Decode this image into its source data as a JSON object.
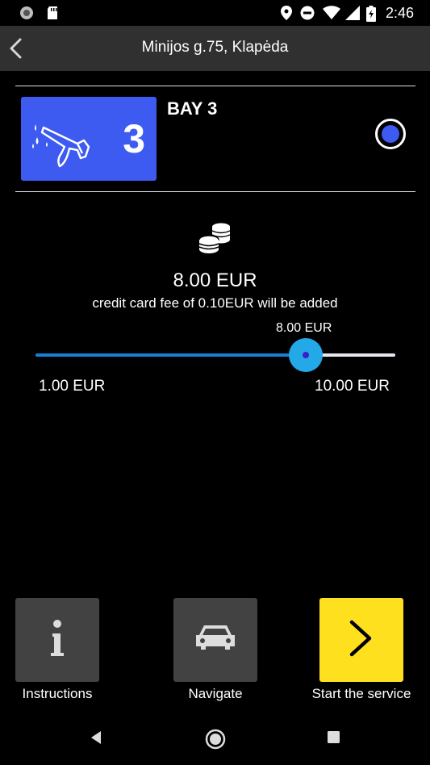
{
  "status_bar": {
    "time": "2:46"
  },
  "app_bar": {
    "title": "Minijos g.75, Klapėda"
  },
  "bay": {
    "number": "3",
    "title": "BAY 3",
    "accent_color": "#3d5af1"
  },
  "payment": {
    "amount": "8.00 EUR",
    "fee_notice": "credit card fee of 0.10EUR will be added"
  },
  "slider": {
    "current_label": "8.00 EUR",
    "min_label": "1.00 EUR",
    "max_label": "10.00 EUR",
    "value": 8.0,
    "min": 1.0,
    "max": 10.0
  },
  "actions": {
    "instructions": "Instructions",
    "navigate": "Navigate",
    "start": "Start the service"
  },
  "icons": [
    "back-icon",
    "spray-gun-icon",
    "coins-icon",
    "info-icon",
    "car-icon",
    "chevron-right-icon"
  ]
}
